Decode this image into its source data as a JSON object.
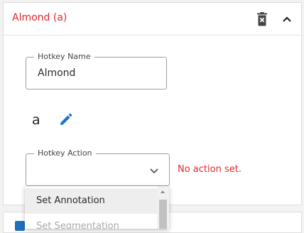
{
  "panel": {
    "title": "Almond (a)",
    "title_color": "#e0262b",
    "delete_icon": "trash-icon",
    "collapse_icon": "chevron-up-icon"
  },
  "hotkey_name": {
    "label": "Hotkey Name",
    "value": "Almond"
  },
  "hotkey": {
    "letter": "a",
    "edit_icon": "pencil-icon",
    "edit_icon_color": "#1a73c8"
  },
  "hotkey_action": {
    "label": "Hotkey Action",
    "value": "",
    "dropdown_icon": "chevron-down-icon",
    "error": "No action set.",
    "error_color": "#e0262b"
  },
  "dropdown": {
    "options": [
      "Set Annotation",
      "Set Segmentation"
    ]
  }
}
